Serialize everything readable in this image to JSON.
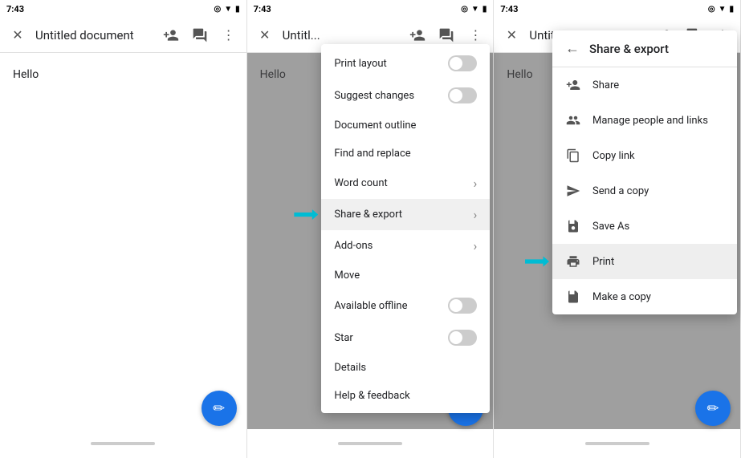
{
  "panel1": {
    "time": "7:43",
    "title": "Untitled document",
    "hello": "Hello",
    "fab_icon": "✏",
    "status_icons": "◎ ▼ ⬛"
  },
  "panel2": {
    "time": "7:43",
    "title": "Untitl...",
    "hello": "Hello",
    "fab_icon": "✏",
    "menu": {
      "items": [
        {
          "label": "Print layout",
          "type": "toggle",
          "value": false
        },
        {
          "label": "Suggest changes",
          "type": "toggle",
          "value": false
        },
        {
          "label": "Document outline",
          "type": "plain"
        },
        {
          "label": "Find and replace",
          "type": "plain"
        },
        {
          "label": "Word count",
          "type": "chevron"
        },
        {
          "label": "Share & export",
          "type": "chevron",
          "highlighted": true
        },
        {
          "label": "Add-ons",
          "type": "chevron"
        },
        {
          "label": "Move",
          "type": "plain"
        },
        {
          "label": "Available offline",
          "type": "toggle",
          "value": false
        },
        {
          "label": "Star",
          "type": "toggle",
          "value": false
        },
        {
          "label": "Details",
          "type": "plain"
        },
        {
          "label": "Help & feedback",
          "type": "plain"
        }
      ]
    }
  },
  "panel3": {
    "time": "7:43",
    "title": "Untitl...",
    "hello": "Hello",
    "fab_icon": "✏",
    "submenu": {
      "header": "Share & export",
      "back_icon": "←",
      "items": [
        {
          "label": "Share",
          "icon": "person_add"
        },
        {
          "label": "Manage people and links",
          "icon": "manage_people"
        },
        {
          "label": "Copy link",
          "icon": "copy_link"
        },
        {
          "label": "Send a copy",
          "icon": "send_copy"
        },
        {
          "label": "Save As",
          "icon": "save_as"
        },
        {
          "label": "Print",
          "icon": "print",
          "highlighted": true
        },
        {
          "label": "Make a copy",
          "icon": "make_copy"
        }
      ]
    }
  }
}
